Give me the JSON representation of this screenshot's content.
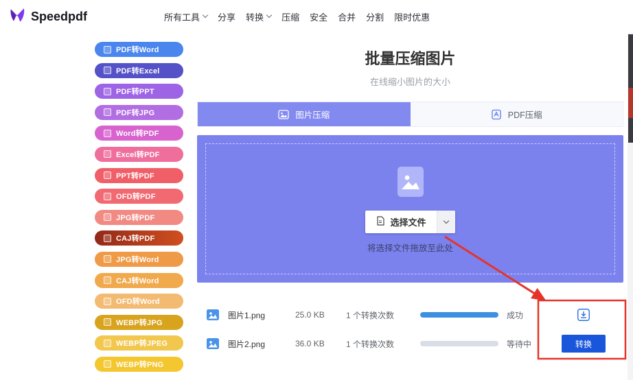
{
  "navbar": {
    "brand": "Speedpdf",
    "items": [
      {
        "label": "所有工具",
        "dropdown": true
      },
      {
        "label": "分享",
        "dropdown": false
      },
      {
        "label": "转换",
        "dropdown": true
      },
      {
        "label": "压缩",
        "dropdown": false
      },
      {
        "label": "安全",
        "dropdown": false
      },
      {
        "label": "合并",
        "dropdown": false
      },
      {
        "label": "分割",
        "dropdown": false
      },
      {
        "label": "限时优惠",
        "dropdown": false
      }
    ]
  },
  "sidebar": {
    "items": [
      {
        "label": "PDF转Word",
        "color": "#4a86ee"
      },
      {
        "label": "PDF转Excel",
        "color": "#5552c8"
      },
      {
        "label": "PDF转PPT",
        "color": "#9d64e6"
      },
      {
        "label": "PDF转JPG",
        "color": "#b16ee2"
      },
      {
        "label": "Word转PDF",
        "color": "#d863cf"
      },
      {
        "label": "Excel转PDF",
        "color": "#ef6e9b"
      },
      {
        "label": "PPT转PDF",
        "color": "#f05f68"
      },
      {
        "label": "OFD转PDF",
        "color": "#f16a72"
      },
      {
        "label": "JPG转PDF",
        "color": "#f28a84"
      },
      {
        "label": "CAJ转PDF",
        "color": "linear-gradient(90deg,#93291a,#cf4f1f)"
      },
      {
        "label": "JPG转Word",
        "color": "#ef9a47"
      },
      {
        "label": "CAJ转Word",
        "color": "#f1a94d"
      },
      {
        "label": "OFD转Word",
        "color": "#f3bb72"
      },
      {
        "label": "WEBP转JPG",
        "color": "#d9a41d"
      },
      {
        "label": "WEBP转JPEG",
        "color": "#f2c74e"
      },
      {
        "label": "WEBP转PNG",
        "color": "#f4c62f"
      }
    ]
  },
  "main": {
    "title": "批量压缩图片",
    "subtitle": "在线缩小图片的大小",
    "tabs": [
      {
        "label": "图片压缩",
        "active": true
      },
      {
        "label": "PDF压缩",
        "active": false
      }
    ],
    "dropzone": {
      "select_button": "选择文件",
      "hint": "将选择文件拖放至此处"
    },
    "files": [
      {
        "name": "图片1.png",
        "size": "25.0 KB",
        "conversions": "1 个转换次数",
        "progress": 100,
        "status": "成功",
        "action": "download"
      },
      {
        "name": "图片2.png",
        "size": "36.0 KB",
        "conversions": "1 个转换次数",
        "progress": 0,
        "status": "等待中",
        "action": "convert"
      }
    ],
    "convert_button_label": "转换"
  },
  "colors": {
    "dropzone_purple": "#7b82ee",
    "tab_active_purple": "#8289ef",
    "progress_blue": "#3d8fe0",
    "convert_blue": "#1a56db",
    "annotation_red": "#e5332a"
  }
}
